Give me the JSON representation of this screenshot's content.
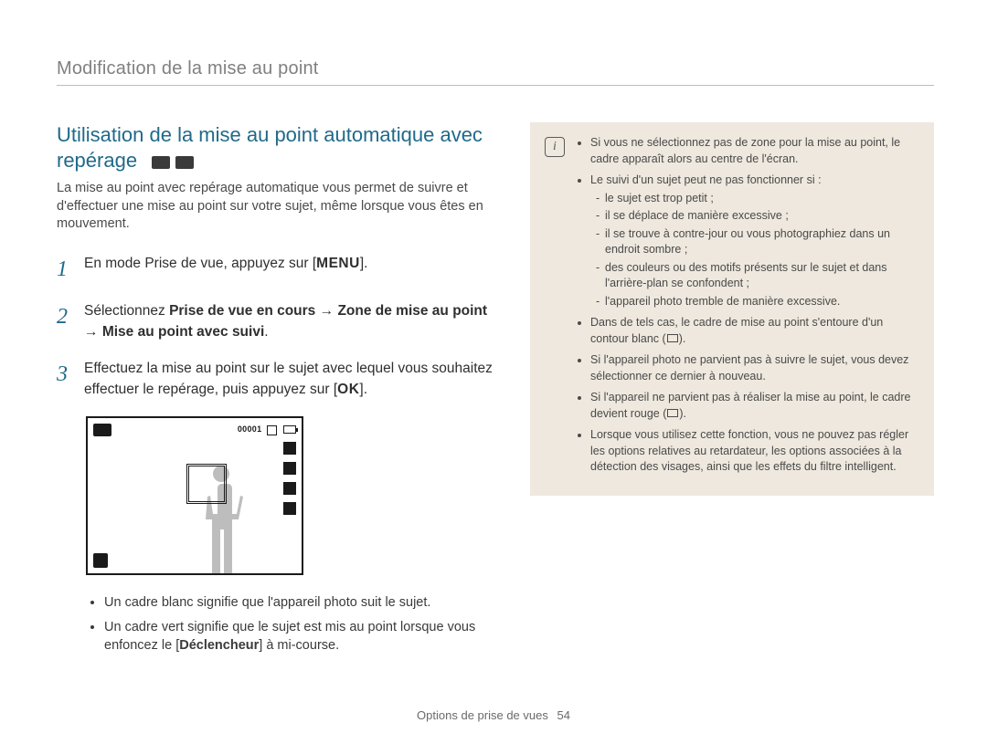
{
  "header": {
    "title": "Modification de la mise au point"
  },
  "main": {
    "heading": "Utilisation de la mise au point automatique avec repérage",
    "intro": "La mise au point avec repérage automatique vous permet de suivre et d'effectuer une mise au point sur votre sujet, même lorsque vous êtes en mouvement.",
    "steps": {
      "n1": "1",
      "s1a": "En mode Prise de vue, appuyez sur [",
      "s1key": "MENU",
      "s1b": "].",
      "n2": "2",
      "s2a": "Sélectionnez ",
      "s2b1": "Prise de vue en cours",
      "s2arrow1": " → ",
      "s2b2": "Zone de mise au point",
      "s2arrow2": " → ",
      "s2b3": "Mise au point avec suivi",
      "s2c": ".",
      "n3": "3",
      "s3a": "Effectuez la mise au point sur le sujet avec lequel vous souhaitez effectuer le repérage, puis appuyez sur [",
      "s3key": "OK",
      "s3b": "]."
    },
    "illus": {
      "counter": "00001"
    },
    "bullets": {
      "b1": "Un cadre blanc signifie que l'appareil photo suit le sujet.",
      "b2a": "Un cadre vert signifie que le sujet est mis au point lorsque vous enfoncez le [",
      "b2bold": "Déclencheur",
      "b2b": "] à mi-course."
    }
  },
  "note": {
    "i1": "Si vous ne sélectionnez pas de zone pour la mise au point, le cadre apparaît alors au centre de l'écran.",
    "i2": "Le suivi d'un sujet peut ne pas fonctionner si :",
    "i2a": "le sujet est trop petit ;",
    "i2b": "il se déplace de manière excessive ;",
    "i2c": "il se trouve à contre-jour ou vous photographiez dans un endroit sombre ;",
    "i2d": "des couleurs ou des motifs présents sur le sujet et dans l'arrière-plan se confondent ;",
    "i2e": "l'appareil photo tremble de manière excessive.",
    "i3a": "Dans de tels cas, le cadre de mise au point s'entoure d'un contour blanc (",
    "i3b": ").",
    "i4": "Si l'appareil photo ne parvient pas à suivre le sujet, vous devez sélectionner ce dernier à nouveau.",
    "i5a": "Si l'appareil ne parvient pas à réaliser la mise au point, le cadre devient rouge (",
    "i5b": ").",
    "i6": "Lorsque vous utilisez cette fonction, vous ne pouvez pas régler les options relatives au retardateur, les options associées à la détection des visages, ainsi que les effets du filtre intelligent."
  },
  "footer": {
    "section": "Options de prise de vues",
    "page": "54"
  }
}
